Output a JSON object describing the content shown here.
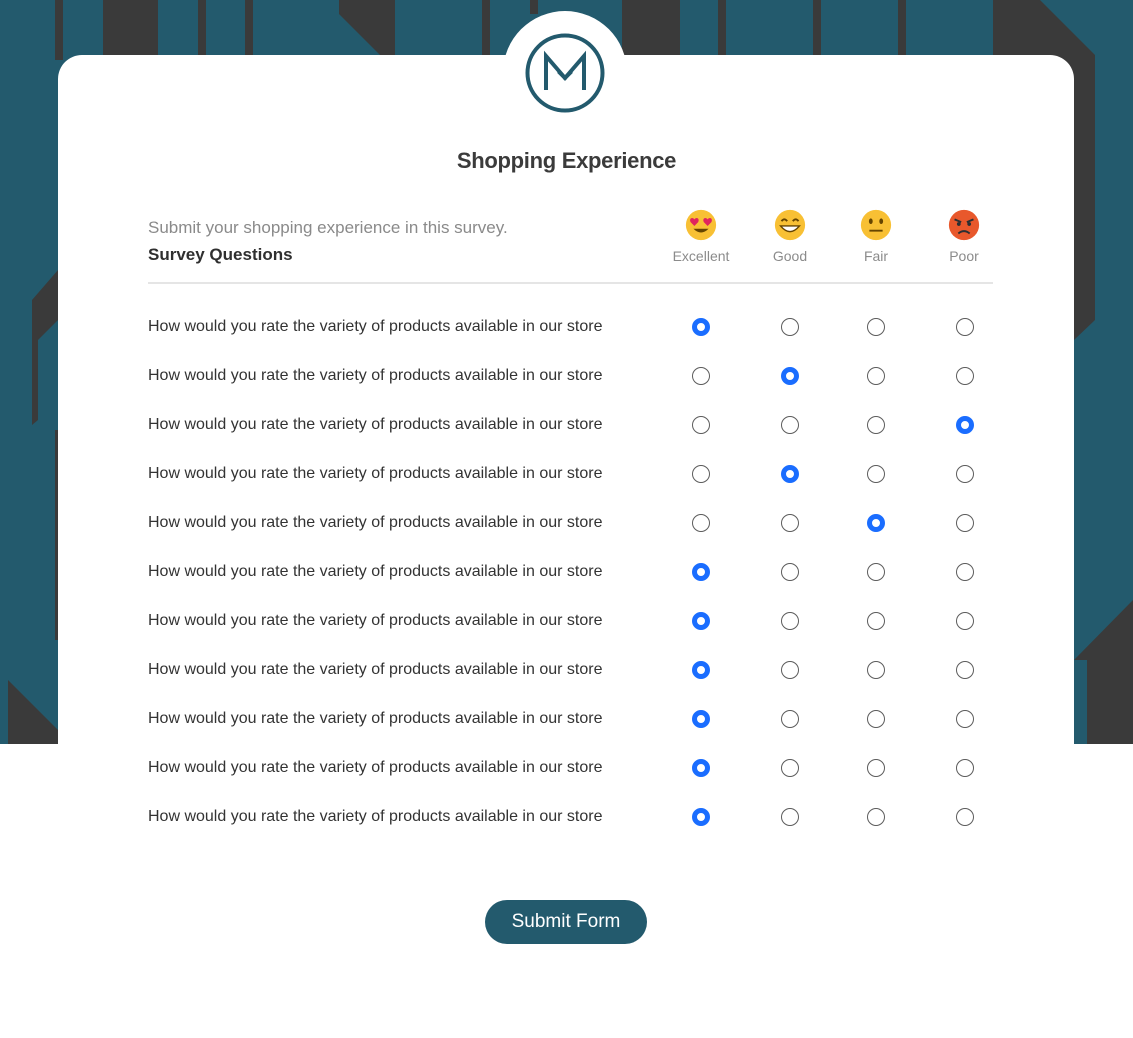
{
  "survey": {
    "title": "Shopping Experience",
    "subtitle": "Submit your shopping experience in this survey.",
    "section_label": "Survey Questions",
    "columns": [
      {
        "label": "Excellent",
        "icon": "heart-eyes-emoji-icon"
      },
      {
        "label": "Good",
        "icon": "grinning-emoji-icon"
      },
      {
        "label": "Fair",
        "icon": "neutral-emoji-icon"
      },
      {
        "label": "Poor",
        "icon": "angry-emoji-icon"
      }
    ],
    "questions": [
      {
        "text": "How would you rate the variety of products available in our store",
        "selected": "Excellent"
      },
      {
        "text": "How would you rate the variety of products available in our store",
        "selected": "Good"
      },
      {
        "text": "How would you rate the variety of products available in our store",
        "selected": "Poor"
      },
      {
        "text": "How would you rate the variety of products available in our store",
        "selected": "Good"
      },
      {
        "text": "How would you rate the variety of products available in our store",
        "selected": "Fair"
      },
      {
        "text": "How would you rate the variety of products available in our store",
        "selected": "Excellent"
      },
      {
        "text": "How would you rate the variety of products available in our store",
        "selected": "Excellent"
      },
      {
        "text": "How would you rate the variety of products available in our store",
        "selected": "Excellent"
      },
      {
        "text": "How would you rate the variety of products available in our store",
        "selected": "Excellent"
      },
      {
        "text": "How would you rate the variety of products available in our store",
        "selected": "Excellent"
      },
      {
        "text": "How would you rate the variety of products available in our store",
        "selected": "Excellent"
      }
    ],
    "submit_label": "Submit Form"
  },
  "colors": {
    "brand": "#235a6d",
    "radio_selected": "#1a6dff",
    "background_dark": "#3a3a3a"
  }
}
